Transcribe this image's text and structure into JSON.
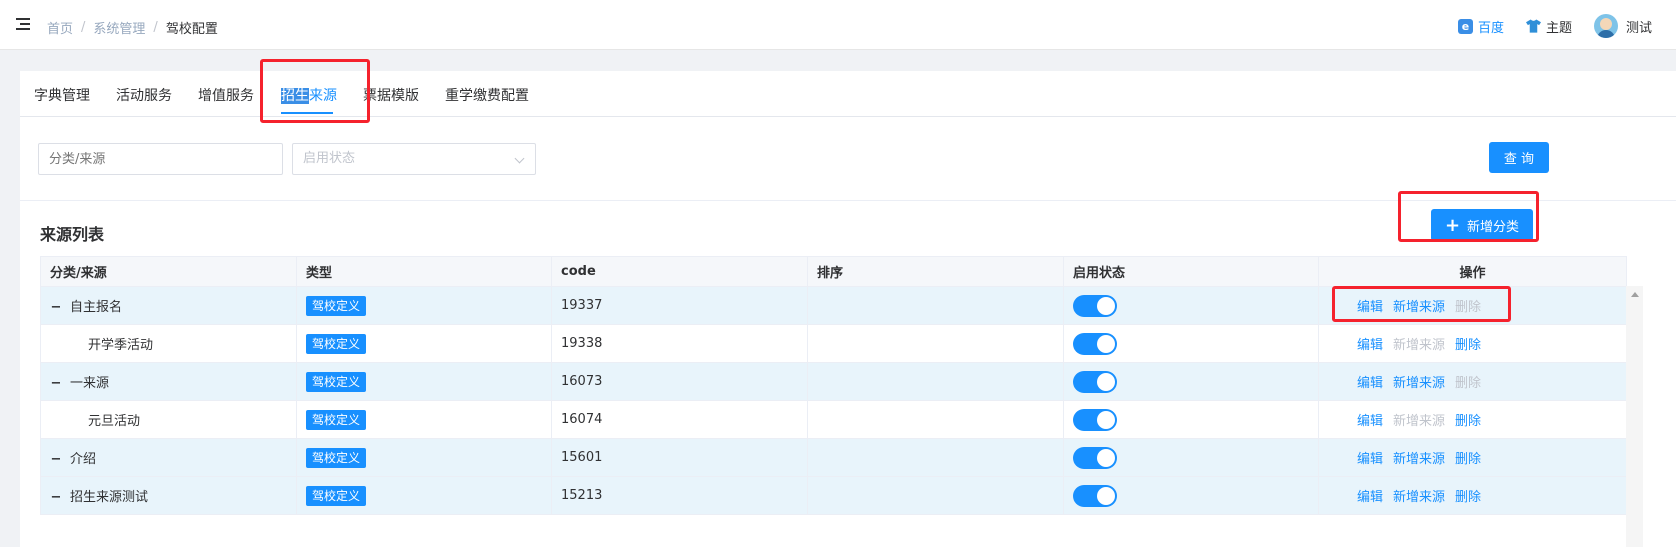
{
  "breadcrumb": [
    "首页",
    "系统管理",
    "驾校配置"
  ],
  "topRight": {
    "baidu_icon": "e",
    "baidu": "百度",
    "theme": "主题",
    "user": "测试"
  },
  "tabs": [
    {
      "label": "字典管理"
    },
    {
      "label": "活动服务"
    },
    {
      "label": "增值服务"
    },
    {
      "label_hl": "招生",
      "label_rest": "来源",
      "active": true
    },
    {
      "label": "票据模版"
    },
    {
      "label": "重学缴费配置"
    }
  ],
  "search": {
    "category_placeholder": "分类/来源",
    "status_placeholder": "启用状态",
    "query_label": "查 询"
  },
  "list": {
    "title": "来源列表",
    "add_label": "新增分类",
    "add_icon": "+"
  },
  "table": {
    "headers": [
      "分类/来源",
      "类型",
      "code",
      "排序",
      "启用状态",
      "操作"
    ],
    "rows": [
      {
        "name": "自主报名",
        "parent": true,
        "type": "驾校定义",
        "code": "19337",
        "sort": "",
        "enabled": true,
        "ops": [
          {
            "label": "编辑",
            "enabled": true
          },
          {
            "label": "新增来源",
            "enabled": true
          },
          {
            "label": "删除",
            "enabled": false
          }
        ]
      },
      {
        "name": "开学季活动",
        "parent": false,
        "type": "驾校定义",
        "code": "19338",
        "sort": "",
        "enabled": true,
        "ops": [
          {
            "label": "编辑",
            "enabled": true
          },
          {
            "label": "新增来源",
            "enabled": false
          },
          {
            "label": "删除",
            "enabled": true
          }
        ]
      },
      {
        "name": "一来源",
        "parent": true,
        "type": "驾校定义",
        "code": "16073",
        "sort": "",
        "enabled": true,
        "ops": [
          {
            "label": "编辑",
            "enabled": true
          },
          {
            "label": "新增来源",
            "enabled": true
          },
          {
            "label": "删除",
            "enabled": false
          }
        ]
      },
      {
        "name": "元旦活动",
        "parent": false,
        "type": "驾校定义",
        "code": "16074",
        "sort": "",
        "enabled": true,
        "ops": [
          {
            "label": "编辑",
            "enabled": true
          },
          {
            "label": "新增来源",
            "enabled": false
          },
          {
            "label": "删除",
            "enabled": true
          }
        ]
      },
      {
        "name": "介绍",
        "parent": true,
        "type": "驾校定义",
        "code": "15601",
        "sort": "",
        "enabled": true,
        "ops": [
          {
            "label": "编辑",
            "enabled": true
          },
          {
            "label": "新增来源",
            "enabled": true
          },
          {
            "label": "删除",
            "enabled": true
          }
        ]
      },
      {
        "name": "招生来源测试",
        "parent": true,
        "type": "驾校定义",
        "code": "15213",
        "sort": "",
        "enabled": true,
        "ops": [
          {
            "label": "编辑",
            "enabled": true
          },
          {
            "label": "新增来源",
            "enabled": true
          },
          {
            "label": "删除",
            "enabled": true
          }
        ]
      }
    ]
  },
  "colors": {
    "primary": "#1890ff",
    "highlight_box": "#f5222d",
    "parent_row": "#e8f4fb"
  }
}
